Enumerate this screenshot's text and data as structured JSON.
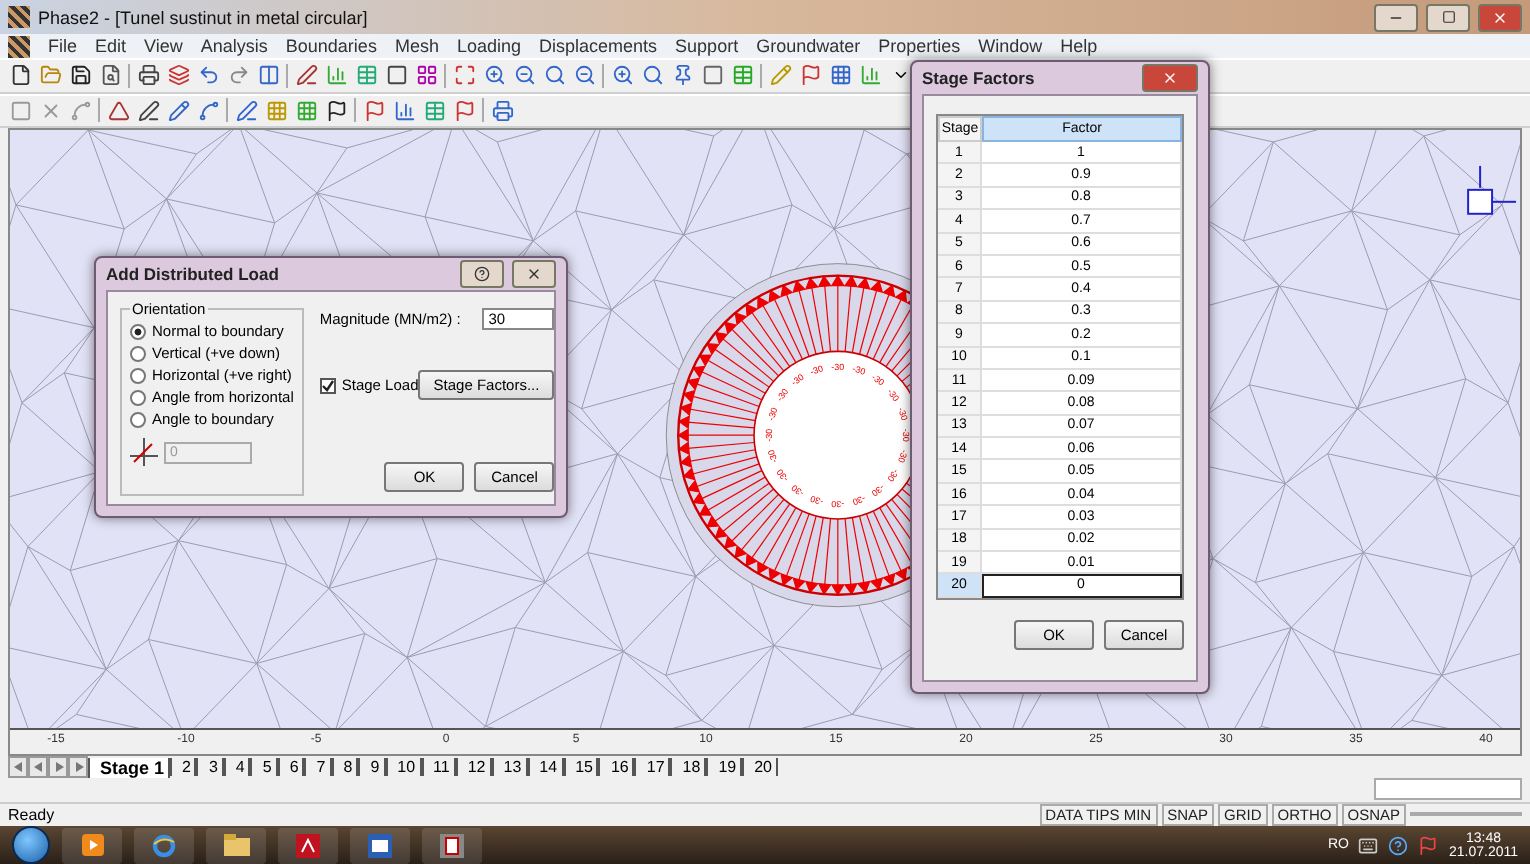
{
  "window": {
    "title": "Phase2 - [Tunel sustinut in metal circular]"
  },
  "menu": [
    "File",
    "Edit",
    "View",
    "Analysis",
    "Boundaries",
    "Mesh",
    "Loading",
    "Displacements",
    "Support",
    "Groundwater",
    "Properties",
    "Window",
    "Help"
  ],
  "canvas": {
    "x_ticks": [
      "-15",
      "-10",
      "-5",
      "0",
      "5",
      "10",
      "15",
      "20",
      "25",
      "30",
      "35",
      "40"
    ],
    "load_labels": [
      "-30",
      "-30",
      "-30",
      "-30",
      "-30",
      "-30",
      "-30",
      "-30",
      "-30",
      "-30",
      "-30",
      "-30",
      "-30",
      "-30",
      "-30",
      "-30",
      "-30",
      "-30",
      "-30",
      "-30"
    ]
  },
  "stage_tabs": [
    {
      "label": "Stage 1",
      "selected": true
    },
    {
      "label": "2",
      "selected": false
    },
    {
      "label": "3",
      "selected": false
    },
    {
      "label": "4",
      "selected": false
    },
    {
      "label": "5",
      "selected": false
    },
    {
      "label": "6",
      "selected": false
    },
    {
      "label": "7",
      "selected": false
    },
    {
      "label": "8",
      "selected": false
    },
    {
      "label": "9",
      "selected": false
    },
    {
      "label": "10",
      "selected": false
    },
    {
      "label": "11",
      "selected": false
    },
    {
      "label": "12",
      "selected": false
    },
    {
      "label": "13",
      "selected": false
    },
    {
      "label": "14",
      "selected": false
    },
    {
      "label": "15",
      "selected": false
    },
    {
      "label": "16",
      "selected": false
    },
    {
      "label": "17",
      "selected": false
    },
    {
      "label": "18",
      "selected": false
    },
    {
      "label": "19",
      "selected": false
    },
    {
      "label": "20",
      "selected": false
    }
  ],
  "status_bar": {
    "message": "Ready",
    "indicators": [
      "DATA TIPS MIN",
      "SNAP",
      "GRID",
      "ORTHO",
      "OSNAP"
    ]
  },
  "taskbar": {
    "language": "RO",
    "time": "13:48",
    "date": "21.07.2011"
  },
  "distributed_load_dialog": {
    "title": "Add Distributed Load",
    "orientation": {
      "label": "Orientation",
      "options": [
        {
          "label": "Normal to boundary",
          "selected": true
        },
        {
          "label": "Vertical (+ve down)",
          "selected": false
        },
        {
          "label": "Horizontal (+ve right)",
          "selected": false
        },
        {
          "label": "Angle from horizontal",
          "selected": false
        },
        {
          "label": "Angle to boundary",
          "selected": false
        }
      ]
    },
    "angle_field": {
      "value": "0",
      "disabled": true
    },
    "magnitude": {
      "label": "Magnitude (MN/m2) :",
      "value": "30"
    },
    "stage_load": {
      "label": "Stage Load",
      "checked": true
    },
    "stage_factors_button": "Stage Factors...",
    "buttons": [
      "OK",
      "Cancel"
    ]
  },
  "stage_factors_dialog": {
    "title": "Stage Factors",
    "columns": [
      "Stage",
      "Factor"
    ],
    "rows": [
      {
        "stage": "1",
        "factor": "1",
        "selected": false
      },
      {
        "stage": "2",
        "factor": "0.9",
        "selected": false
      },
      {
        "stage": "3",
        "factor": "0.8",
        "selected": false
      },
      {
        "stage": "4",
        "factor": "0.7",
        "selected": false
      },
      {
        "stage": "5",
        "factor": "0.6",
        "selected": false
      },
      {
        "stage": "6",
        "factor": "0.5",
        "selected": false
      },
      {
        "stage": "7",
        "factor": "0.4",
        "selected": false
      },
      {
        "stage": "8",
        "factor": "0.3",
        "selected": false
      },
      {
        "stage": "9",
        "factor": "0.2",
        "selected": false
      },
      {
        "stage": "10",
        "factor": "0.1",
        "selected": false
      },
      {
        "stage": "11",
        "factor": "0.09",
        "selected": false
      },
      {
        "stage": "12",
        "factor": "0.08",
        "selected": false
      },
      {
        "stage": "13",
        "factor": "0.07",
        "selected": false
      },
      {
        "stage": "14",
        "factor": "0.06",
        "selected": false
      },
      {
        "stage": "15",
        "factor": "0.05",
        "selected": false
      },
      {
        "stage": "16",
        "factor": "0.04",
        "selected": false
      },
      {
        "stage": "17",
        "factor": "0.03",
        "selected": false
      },
      {
        "stage": "18",
        "factor": "0.02",
        "selected": false
      },
      {
        "stage": "19",
        "factor": "0.01",
        "selected": false
      },
      {
        "stage": "20",
        "factor": "0",
        "selected": true
      }
    ],
    "buttons": [
      "OK",
      "Cancel"
    ]
  }
}
